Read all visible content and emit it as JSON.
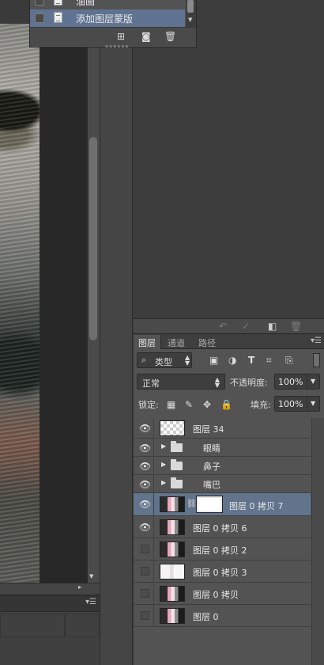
{
  "history": {
    "items": [
      {
        "label": "油画"
      },
      {
        "label": "添加图层蒙版"
      }
    ],
    "footer_icons": [
      "new-document-from-state-icon",
      "camera-icon",
      "trash-icon"
    ]
  },
  "upper_panel_footer_icons": [
    "undo-icon",
    "check-icon",
    "new-icon",
    "trash-icon"
  ],
  "layers_panel": {
    "tabs": [
      {
        "label": "图层",
        "active": true
      },
      {
        "label": "通道",
        "active": false
      },
      {
        "label": "路径",
        "active": false
      }
    ],
    "filter": {
      "kind_label": "类型",
      "filter_icons": [
        "image-filter-icon",
        "adjustment-filter-icon",
        "type-filter-icon",
        "shape-filter-icon",
        "smart-object-filter-icon"
      ]
    },
    "blend_mode": "正常",
    "opacity_label": "不透明度:",
    "opacity_value": "100%",
    "lock_label": "锁定:",
    "lock_icons": [
      "lock-transparent-pixels-icon",
      "lock-image-pixels-icon",
      "lock-position-icon",
      "lock-all-icon"
    ],
    "fill_label": "填充:",
    "fill_value": "100%",
    "layers": [
      {
        "name": "图层 34",
        "visible": true,
        "type": "layer",
        "thumb": "transparent"
      },
      {
        "name": "眼睛",
        "visible": true,
        "type": "group"
      },
      {
        "name": "鼻子",
        "visible": true,
        "type": "group"
      },
      {
        "name": "嘴巴",
        "visible": true,
        "type": "group"
      },
      {
        "name": "图层 0 拷贝 7",
        "visible": true,
        "type": "layer",
        "thumb": "photo",
        "mask": true,
        "selected": true
      },
      {
        "name": "图层 0 拷贝 6",
        "visible": true,
        "type": "layer",
        "thumb": "photo"
      },
      {
        "name": "图层 0 拷贝 2",
        "visible": false,
        "type": "layer",
        "thumb": "photo"
      },
      {
        "name": "图层 0 拷贝 3",
        "visible": false,
        "type": "layer",
        "thumb": "faint"
      },
      {
        "name": "图层 0 拷贝",
        "visible": false,
        "type": "layer",
        "thumb": "photo"
      },
      {
        "name": "图层 0",
        "visible": false,
        "type": "layer",
        "thumb": "photo"
      }
    ]
  }
}
